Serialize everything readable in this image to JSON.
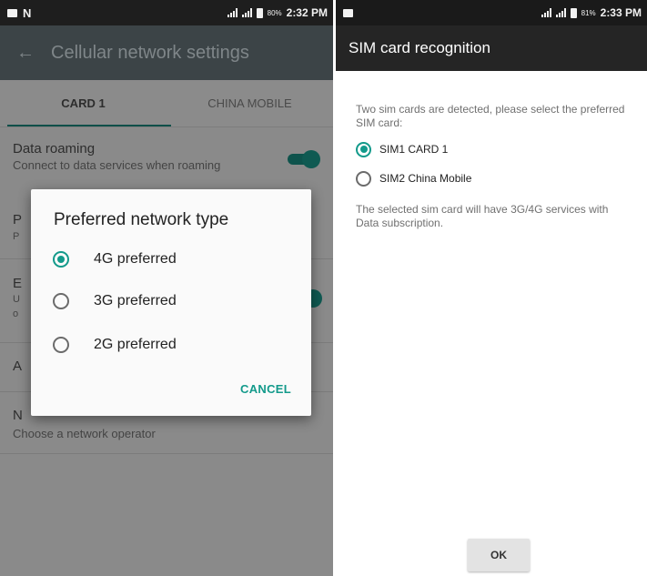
{
  "left_screen": {
    "status_bar": {
      "battery": "80%",
      "time": "2:32 PM"
    },
    "toolbar": {
      "title": "Cellular network settings"
    },
    "tabs": [
      {
        "label": "CARD 1",
        "selected": true
      },
      {
        "label": "CHINA MOBILE",
        "selected": false
      }
    ],
    "settings": {
      "data_roaming": {
        "title": "Data roaming",
        "subtitle": "Connect to data services when roaming",
        "toggle_on": true
      },
      "network_operators": {
        "subtitle": "Choose a network operator"
      }
    },
    "dialog": {
      "title": "Preferred network type",
      "options": [
        {
          "label": "4G preferred",
          "selected": true
        },
        {
          "label": "3G preferred",
          "selected": false
        },
        {
          "label": "2G preferred",
          "selected": false
        }
      ],
      "cancel_label": "CANCEL"
    }
  },
  "right_screen": {
    "status_bar": {
      "battery": "81%",
      "time": "2:33 PM"
    },
    "header": {
      "title": "SIM card recognition"
    },
    "message": "Two sim cards are detected, please select the preferred SIM card:",
    "options": [
      {
        "label": "SIM1 CARD 1",
        "selected": true
      },
      {
        "label": "SIM2 China Mobile",
        "selected": false
      }
    ],
    "note": "The selected sim card will have 3G/4G services with Data subscription.",
    "ok_label": "OK"
  },
  "colors": {
    "accent": "#139a8b",
    "toolbar_dim": "#3c4447",
    "header_dark": "#252525"
  }
}
